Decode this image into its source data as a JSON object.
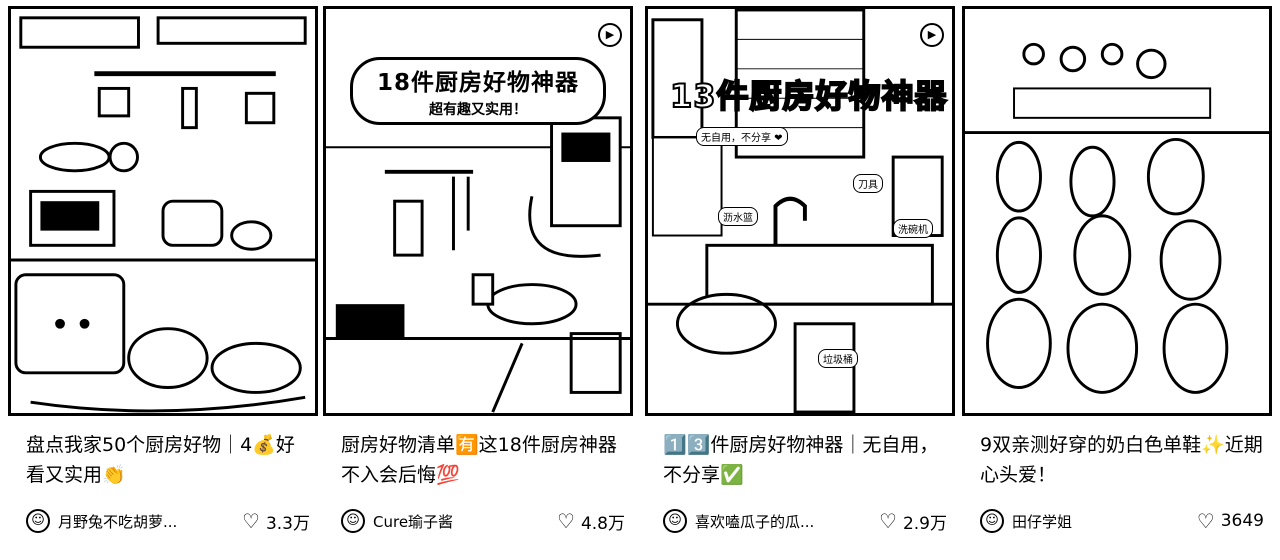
{
  "cards": [
    {
      "title": "盘点我家50个厨房好物｜4💰好看又实用👏",
      "author": "月野兔不吃胡萝...",
      "likes": "3.3万",
      "has_play": false,
      "labels": [
        "",
        "",
        ""
      ]
    },
    {
      "banner_title": "18件厨房好物神器",
      "banner_sub": "超有趣又实用！",
      "title": "厨房好物清单🈶这18件厨房神器不入会后悔💯",
      "author": "Cure瑜子酱",
      "likes": "4.8万",
      "has_play": true
    },
    {
      "banner_title": "13件厨房好物神器",
      "tag_1": "无自用，不分享 ❤",
      "tag_2": "沥水篮",
      "tag_3": "洗碗机",
      "tag_4": "刀具",
      "tag_5": "垃圾桶",
      "title": "1️⃣3️⃣件厨房好物神器｜无自用，不分享✅",
      "author": "喜欢嗑瓜子的瓜...",
      "likes": "2.9万",
      "has_play": true
    },
    {
      "title": "9双亲测好穿的奶白色单鞋✨近期心头爱！",
      "author": "田仔学姐",
      "likes": "3649",
      "has_play": false
    }
  ],
  "icons": {
    "like": "heart-icon",
    "play": "play-icon",
    "avatar": "avatar-icon"
  }
}
